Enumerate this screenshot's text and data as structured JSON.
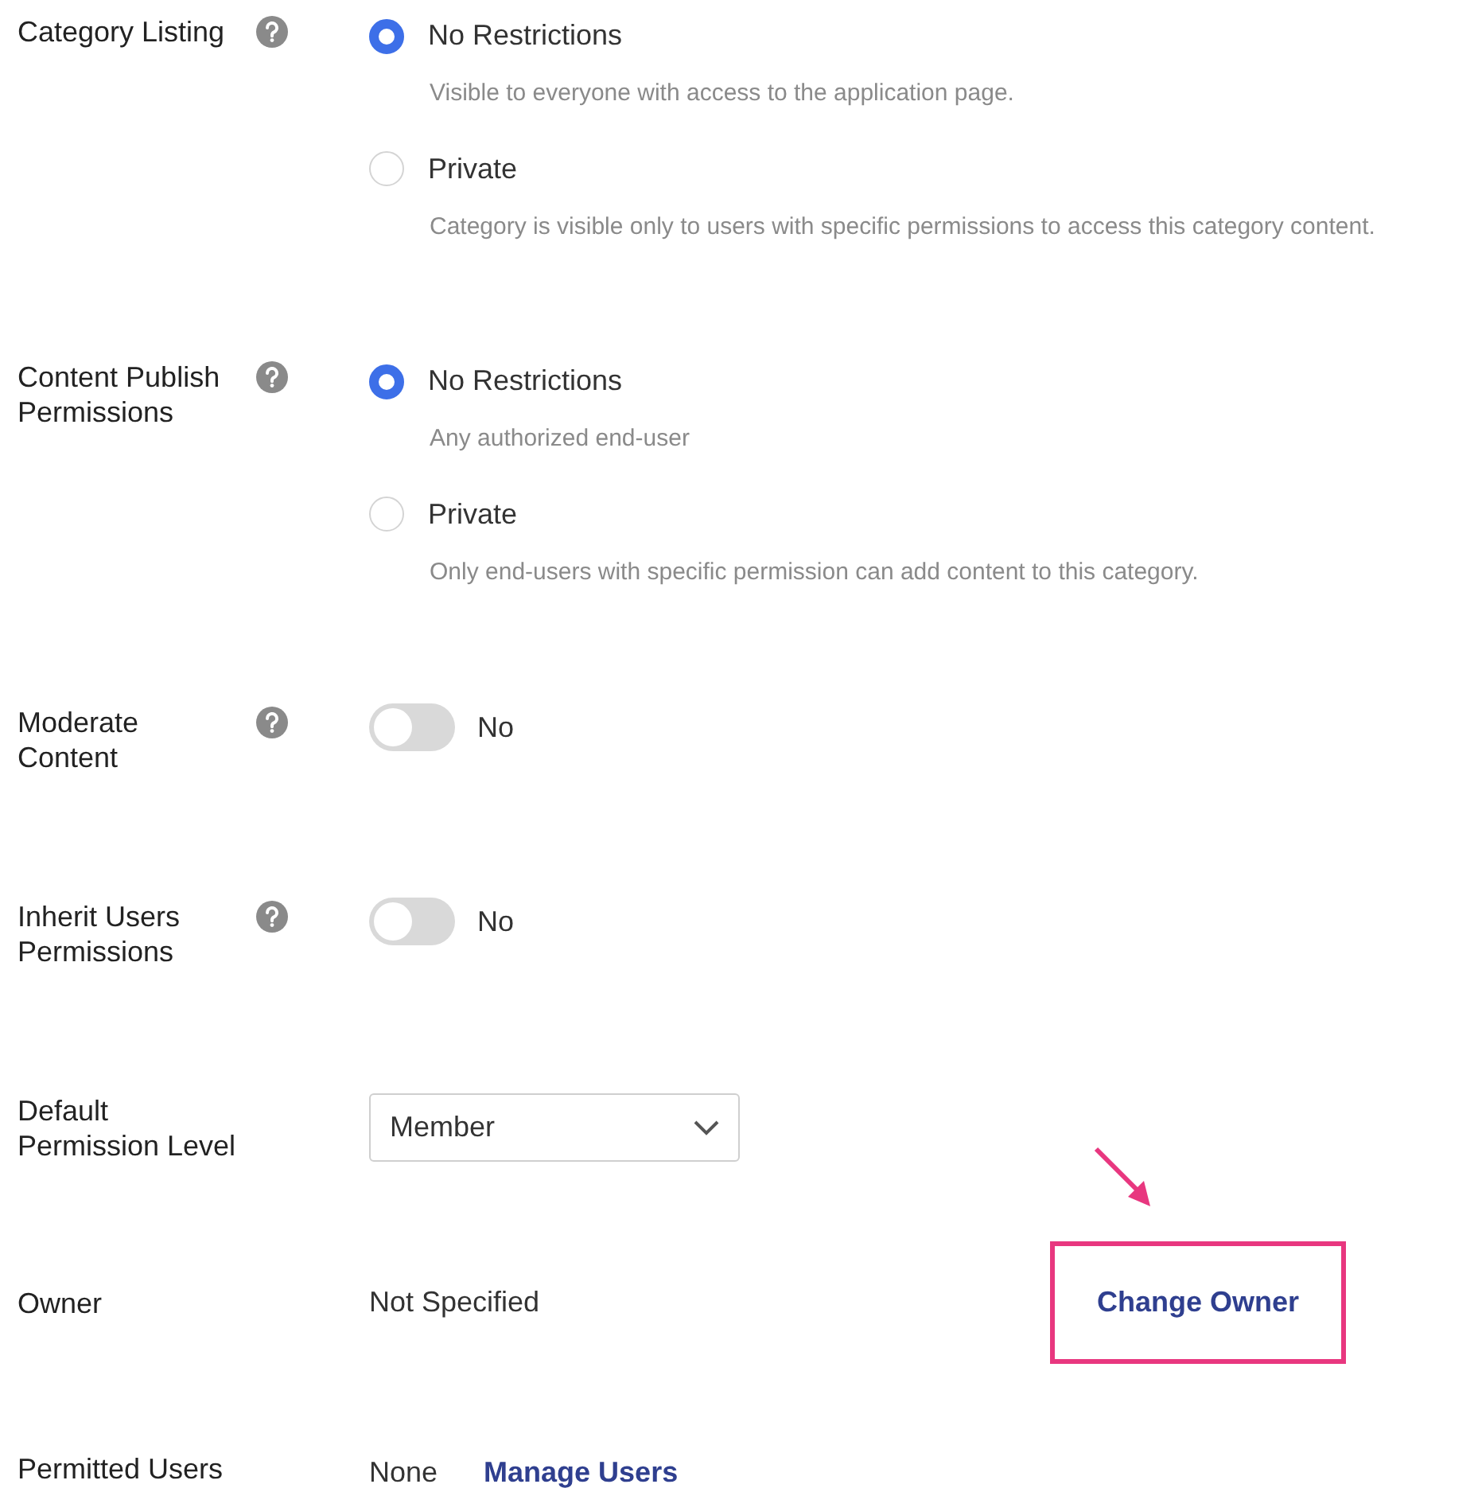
{
  "settings": [
    {
      "kind": "radio",
      "label": "Category Listing",
      "help": true,
      "options": [
        {
          "title": "No Restrictions",
          "description": "Visible to everyone with access to the application page.",
          "selected": true
        },
        {
          "title": "Private",
          "description": "Category is visible only to users with specific permissions to access this category content.",
          "selected": false
        }
      ]
    },
    {
      "kind": "radio",
      "label": "Content Publish Permissions",
      "help": true,
      "options": [
        {
          "title": "No Restrictions",
          "description": "Any authorized end-user",
          "selected": true
        },
        {
          "title": "Private",
          "description": "Only end-users with specific permission can add content to this category.",
          "selected": false
        }
      ]
    },
    {
      "kind": "toggle",
      "label": "Moderate Content",
      "help": true,
      "on": false,
      "value": "No"
    },
    {
      "kind": "toggle",
      "label": "Inherit Users Permissions",
      "help": true,
      "on": false,
      "value": "No"
    },
    {
      "kind": "select",
      "label": "Default Permission Level",
      "value": "Member"
    },
    {
      "kind": "owner",
      "label": "Owner",
      "value": "Not Specified",
      "action": "Change Owner",
      "highlighted": true
    },
    {
      "kind": "users",
      "label": "Permitted Users",
      "value": "None",
      "action": "Manage Users"
    }
  ]
}
